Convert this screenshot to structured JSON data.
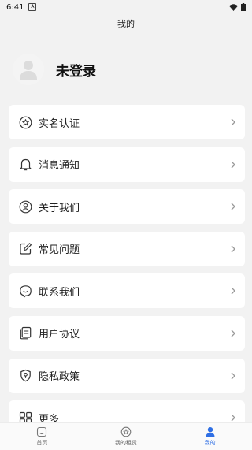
{
  "status_bar": {
    "time": "6:41"
  },
  "header": {
    "title": "我的"
  },
  "profile": {
    "name": "未登录"
  },
  "menu": [
    {
      "label": "实名认证",
      "icon": "badge-star-icon"
    },
    {
      "label": "消息通知",
      "icon": "bell-icon"
    },
    {
      "label": "关于我们",
      "icon": "user-circle-icon"
    },
    {
      "label": "常见问题",
      "icon": "edit-icon"
    },
    {
      "label": "联系我们",
      "icon": "chat-smile-icon"
    },
    {
      "label": "用户协议",
      "icon": "document-icon"
    },
    {
      "label": "隐私政策",
      "icon": "shield-icon"
    },
    {
      "label": "更多",
      "icon": "grid-icon"
    }
  ],
  "tabs": [
    {
      "label": "首页",
      "icon": "home-icon",
      "active": false
    },
    {
      "label": "我的租赁",
      "icon": "badge-icon",
      "active": false
    },
    {
      "label": "我的",
      "icon": "person-icon",
      "active": true
    }
  ],
  "colors": {
    "accent": "#2f6fe4",
    "background": "#f2f2f2",
    "card": "#ffffff"
  }
}
